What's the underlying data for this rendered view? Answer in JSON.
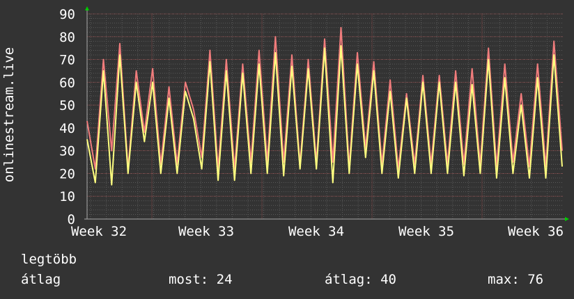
{
  "chart_data": {
    "type": "line",
    "ylabel": "onlinestream.live",
    "ylim": [
      0,
      90
    ],
    "y_ticks": [
      "0",
      "10",
      "20",
      "30",
      "40",
      "50",
      "60",
      "70",
      "80",
      "90"
    ],
    "x_ticks": [
      "Week 32",
      "Week 33",
      "Week 34",
      "Week 35",
      "Week 36"
    ],
    "grid": true,
    "series": [
      {
        "name": "legtöbb",
        "color": "#f07c7c",
        "values": [
          43,
          22,
          70,
          30,
          77,
          22,
          65,
          38,
          66,
          24,
          58,
          24,
          60,
          48,
          27,
          74,
          22,
          70,
          22,
          68,
          25,
          74,
          25,
          80,
          25,
          72,
          24,
          70,
          25,
          79,
          25,
          84,
          23,
          73,
          31,
          69,
          24,
          61,
          22,
          55,
          24,
          63,
          24,
          63,
          24,
          65,
          24,
          66,
          24,
          75,
          23,
          68,
          25,
          55,
          23,
          68,
          23,
          78,
          30
        ]
      },
      {
        "name": "átlag",
        "color": "#ffff80",
        "values": [
          35,
          16,
          65,
          15,
          72,
          20,
          60,
          34,
          60,
          20,
          53,
          20,
          56,
          44,
          22,
          69,
          17,
          65,
          17,
          64,
          20,
          68,
          20,
          73,
          19,
          67,
          22,
          66,
          22,
          75,
          16,
          76,
          20,
          68,
          27,
          65,
          20,
          56,
          18,
          53,
          20,
          60,
          20,
          60,
          20,
          60,
          19,
          59,
          20,
          70,
          18,
          62,
          20,
          50,
          18,
          62,
          18,
          72,
          23
        ]
      }
    ]
  },
  "legend": [
    {
      "label": "legtöbb",
      "color": "#f07c7c"
    },
    {
      "label": "átlag",
      "color": "#ffff80"
    }
  ],
  "stats": {
    "most": "most: 24",
    "atlag": "átlag: 40",
    "max": "max: 76"
  },
  "colors": {
    "background": "#333333",
    "grid": "#5a5a5a",
    "major_grid": "#8a4848",
    "axis": "#aaaaaa",
    "arrow": "#00cc00"
  }
}
